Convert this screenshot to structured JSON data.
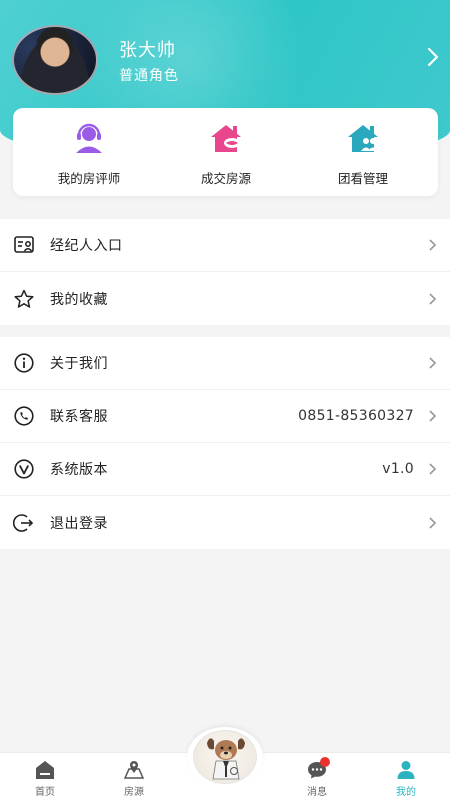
{
  "profile": {
    "name": "张大帅",
    "role": "普通角色"
  },
  "quick_actions": [
    {
      "label": "我的房评师",
      "icon": "headset-person-icon",
      "color": "#9a5ce6"
    },
    {
      "label": "成交房源",
      "icon": "house-handshake-icon",
      "color": "#e8468d"
    },
    {
      "label": "团看管理",
      "icon": "house-group-icon",
      "color": "#2aa8bd"
    }
  ],
  "menu_group_1": [
    {
      "label": "经纪人入口",
      "icon": "agent-id-icon"
    },
    {
      "label": "我的收藏",
      "icon": "star-outline-icon"
    }
  ],
  "menu_group_2": [
    {
      "label": "关于我们",
      "icon": "info-circle-icon",
      "value": ""
    },
    {
      "label": "联系客服",
      "icon": "phone-icon",
      "value": "0851-85360327"
    },
    {
      "label": "系统版本",
      "icon": "version-v-icon",
      "value": "v1.0"
    },
    {
      "label": "退出登录",
      "icon": "logout-icon",
      "value": ""
    }
  ],
  "tabbar": [
    {
      "label": "首页",
      "icon": "home-icon"
    },
    {
      "label": "房源",
      "icon": "map-pin-icon"
    },
    {
      "label": "消息",
      "icon": "chat-bubble-icon",
      "has_badge": true
    },
    {
      "label": "我的",
      "icon": "person-icon",
      "active": true
    }
  ],
  "colors": {
    "header_teal": "#2fc6c7",
    "active_tab": "#2bb3c0",
    "badge_red": "#e8322e"
  }
}
